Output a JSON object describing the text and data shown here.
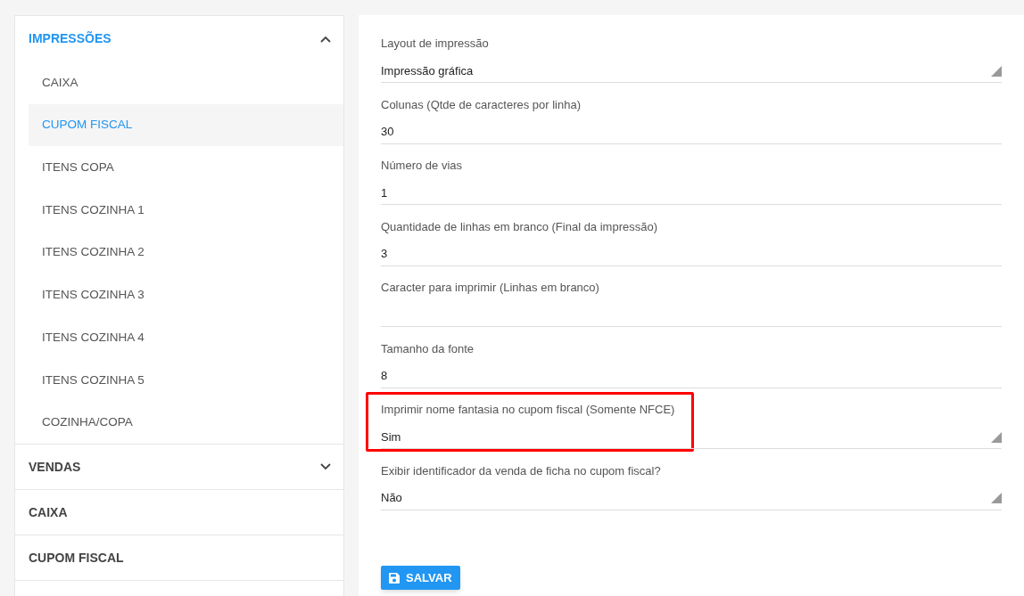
{
  "sidebar": {
    "sections": [
      {
        "title": "IMPRESSÕES",
        "expanded": true,
        "items": [
          {
            "label": "CAIXA",
            "selected": false
          },
          {
            "label": "CUPOM FISCAL",
            "selected": true
          },
          {
            "label": "ITENS COPA",
            "selected": false
          },
          {
            "label": "ITENS COZINHA 1",
            "selected": false
          },
          {
            "label": "ITENS COZINHA 2",
            "selected": false
          },
          {
            "label": "ITENS COZINHA 3",
            "selected": false
          },
          {
            "label": "ITENS COZINHA 4",
            "selected": false
          },
          {
            "label": "ITENS COZINHA 5",
            "selected": false
          },
          {
            "label": "COZINHA/COPA",
            "selected": false
          }
        ]
      },
      {
        "title": "VENDAS",
        "expanded": false
      },
      {
        "title": "CAIXA"
      },
      {
        "title": "CUPOM FISCAL"
      }
    ]
  },
  "form": {
    "fields": [
      {
        "kind": "select",
        "label": "Layout de impressão",
        "value": "Impressão gráfica",
        "highlighted": false
      },
      {
        "kind": "input",
        "label": "Colunas (Qtde de caracteres por linha)",
        "value": "30",
        "highlighted": false
      },
      {
        "kind": "input",
        "label": "Número de vias",
        "value": "1",
        "highlighted": false
      },
      {
        "kind": "input",
        "label": "Quantidade de linhas em branco (Final da impressão)",
        "value": "3",
        "highlighted": false
      },
      {
        "kind": "input",
        "label": "Caracter para imprimir (Linhas em branco)",
        "highlighted": false
      },
      {
        "kind": "input",
        "label": "Tamanho da fonte",
        "value": "8",
        "highlighted": false
      },
      {
        "kind": "select",
        "label": "Imprimir nome fantasia no cupom fiscal (Somente NFCE)",
        "value": "Sim",
        "highlighted": true
      },
      {
        "kind": "select",
        "label": "Exibir identificador da venda de ficha no cupom fiscal?",
        "value": "Não",
        "highlighted": false
      }
    ],
    "save_button": "SALVAR"
  }
}
